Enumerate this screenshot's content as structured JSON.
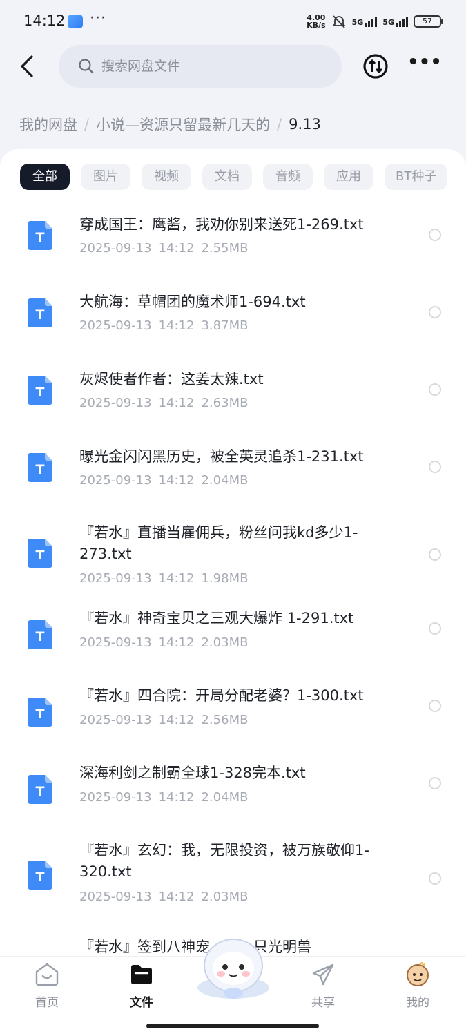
{
  "status_bar": {
    "time": "14:12",
    "net_speed_top": "4.00",
    "net_speed_bottom": "KB/s",
    "sig1": "5G",
    "sig2": "5G",
    "battery": "57"
  },
  "header": {
    "search_placeholder": "搜索网盘文件"
  },
  "breadcrumb": {
    "root": "我的网盘",
    "folder": "小说—资源只留最新几天的",
    "current": "9.13",
    "separator": "/"
  },
  "tabs": [
    "全部",
    "图片",
    "视频",
    "文档",
    "音频",
    "应用",
    "BT种子"
  ],
  "files": [
    {
      "name": "穿成国王：鹰酱，我劝你别来送死1-269.txt",
      "date": "2025-09-13",
      "time": "14:12",
      "size": "2.55MB"
    },
    {
      "name": "大航海：草帽团的魔术师1-694.txt",
      "date": "2025-09-13",
      "time": "14:12",
      "size": "3.87MB"
    },
    {
      "name": "灰烬使者作者：这姜太辣.txt",
      "date": "2025-09-13",
      "time": "14:12",
      "size": "2.63MB"
    },
    {
      "name": "曝光金闪闪黑历史，被全英灵追杀1-231.txt",
      "date": "2025-09-13",
      "time": "14:12",
      "size": "2.04MB"
    },
    {
      "name": "『若水』直播当雇佣兵，粉丝问我kd多少1-273.txt",
      "date": "2025-09-13",
      "time": "14:12",
      "size": "1.98MB"
    },
    {
      "name": "『若水』神奇宝贝之三观大爆炸 1-291.txt",
      "date": "2025-09-13",
      "time": "14:12",
      "size": "2.03MB"
    },
    {
      "name": "『若水』四合院：开局分配老婆？1-300.txt",
      "date": "2025-09-13",
      "time": "14:12",
      "size": "2.56MB"
    },
    {
      "name": "深海利剑之制霸全球1-328完本.txt",
      "date": "2025-09-13",
      "time": "14:12",
      "size": "2.04MB"
    },
    {
      "name": "『若水』玄幻：我，无限投资，被万族敬仰1-320.txt",
      "date": "2025-09-13",
      "time": "14:12",
      "size": "2.03MB"
    },
    {
      "name": "『若水』签到八神宠…得一只光明兽",
      "date": "",
      "time": "",
      "size": ""
    }
  ],
  "file_icon_letter": "T",
  "bottom_nav": {
    "home": "首页",
    "files": "文件",
    "share": "共享",
    "mine": "我的"
  },
  "colors": {
    "accent_dark": "#161b2a",
    "file_icon_blue": "#3e8bf7"
  }
}
